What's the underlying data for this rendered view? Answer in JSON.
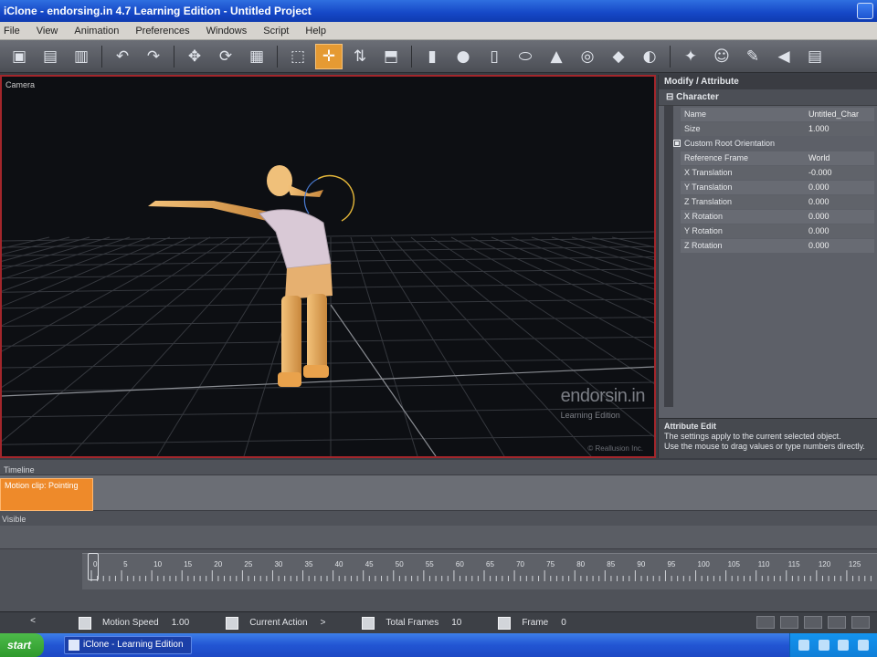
{
  "window": {
    "title": "iClone - endorsing.in 4.7 Learning Edition - Untitled Project"
  },
  "menu": [
    "File",
    "View",
    "Animation",
    "Preferences",
    "Windows",
    "Script",
    "Help"
  ],
  "toolbar": {
    "buttons": [
      {
        "name": "new-project-icon",
        "glyph": "▣"
      },
      {
        "name": "open-icon",
        "glyph": "▤"
      },
      {
        "name": "save-icon",
        "glyph": "▥"
      },
      {
        "name": "undo-icon",
        "glyph": "↶"
      },
      {
        "name": "redo-icon",
        "glyph": "↷"
      },
      {
        "name": "pan-icon",
        "glyph": "✥"
      },
      {
        "name": "orbit-icon",
        "glyph": "⟳"
      },
      {
        "name": "camera-icon",
        "glyph": "▦"
      },
      {
        "name": "select-icon",
        "glyph": "⬚"
      },
      {
        "name": "move-icon",
        "glyph": "✛",
        "active": true
      },
      {
        "name": "rotate-icon",
        "glyph": "⇅"
      },
      {
        "name": "scale-icon",
        "glyph": "⬒"
      },
      {
        "name": "box-primitive-icon",
        "glyph": "▮"
      },
      {
        "name": "sphere-primitive-icon",
        "glyph": "●"
      },
      {
        "name": "cylinder-primitive-icon",
        "glyph": "▯"
      },
      {
        "name": "capsule-primitive-icon",
        "glyph": "⬭"
      },
      {
        "name": "cone-primitive-icon",
        "glyph": "▲"
      },
      {
        "name": "torus-primitive-icon",
        "glyph": "◎"
      },
      {
        "name": "pyramid-primitive-icon",
        "glyph": "◆"
      },
      {
        "name": "plane-primitive-icon",
        "glyph": "◐"
      },
      {
        "name": "light-icon",
        "glyph": "✦"
      },
      {
        "name": "avatar-icon",
        "glyph": "☺"
      },
      {
        "name": "pen-icon",
        "glyph": "✎"
      },
      {
        "name": "audio-icon",
        "glyph": "◀"
      },
      {
        "name": "panel-toggle-icon",
        "glyph": "▤"
      }
    ]
  },
  "viewport": {
    "label": "Camera",
    "watermark": "endorsin.in",
    "watermark_sub": "Learning Edition",
    "footer": "© Reallusion Inc."
  },
  "panel": {
    "header": "Modify / Attribute",
    "section_title": "Character",
    "rows": [
      {
        "key": "Name",
        "value": "Untitled_Char"
      },
      {
        "key": "Size",
        "value": "1.000"
      }
    ],
    "checkbox_label": "Custom Root Orientation",
    "transform_rows": [
      {
        "key": "Reference Frame",
        "value": "World"
      },
      {
        "key": "X Translation",
        "value": "-0.000"
      },
      {
        "key": "Y Translation",
        "value": "0.000"
      },
      {
        "key": "Z Translation",
        "value": "0.000"
      },
      {
        "key": "X Rotation",
        "value": "0.000"
      },
      {
        "key": "Y Rotation",
        "value": "0.000"
      },
      {
        "key": "Z Rotation",
        "value": "0.000"
      }
    ],
    "help_title": "Attribute Edit",
    "help_text": "The settings apply to the current selected object.",
    "help_text2": "Use the mouse to drag values or type numbers directly."
  },
  "timeline": {
    "title": "Timeline",
    "clip_label": "Motion clip: Pointing",
    "track2_label": "Visible",
    "ruler_ticks": [
      "0",
      "5",
      "10",
      "15",
      "20",
      "25",
      "30",
      "35",
      "40",
      "45",
      "50",
      "55",
      "60",
      "65",
      "70",
      "75",
      "80",
      "85",
      "90",
      "95",
      "100",
      "105",
      "110",
      "115",
      "120",
      "125"
    ]
  },
  "status": {
    "nav": "<",
    "items": [
      {
        "label": "Motion Speed",
        "value": "1.00"
      },
      {
        "label": "Current Action",
        "value": ">"
      },
      {
        "label": "Total Frames",
        "value": "10"
      },
      {
        "label": "Frame",
        "value": "0"
      }
    ]
  },
  "taskbar": {
    "start": "start",
    "task": "iClone - Learning Edition"
  }
}
